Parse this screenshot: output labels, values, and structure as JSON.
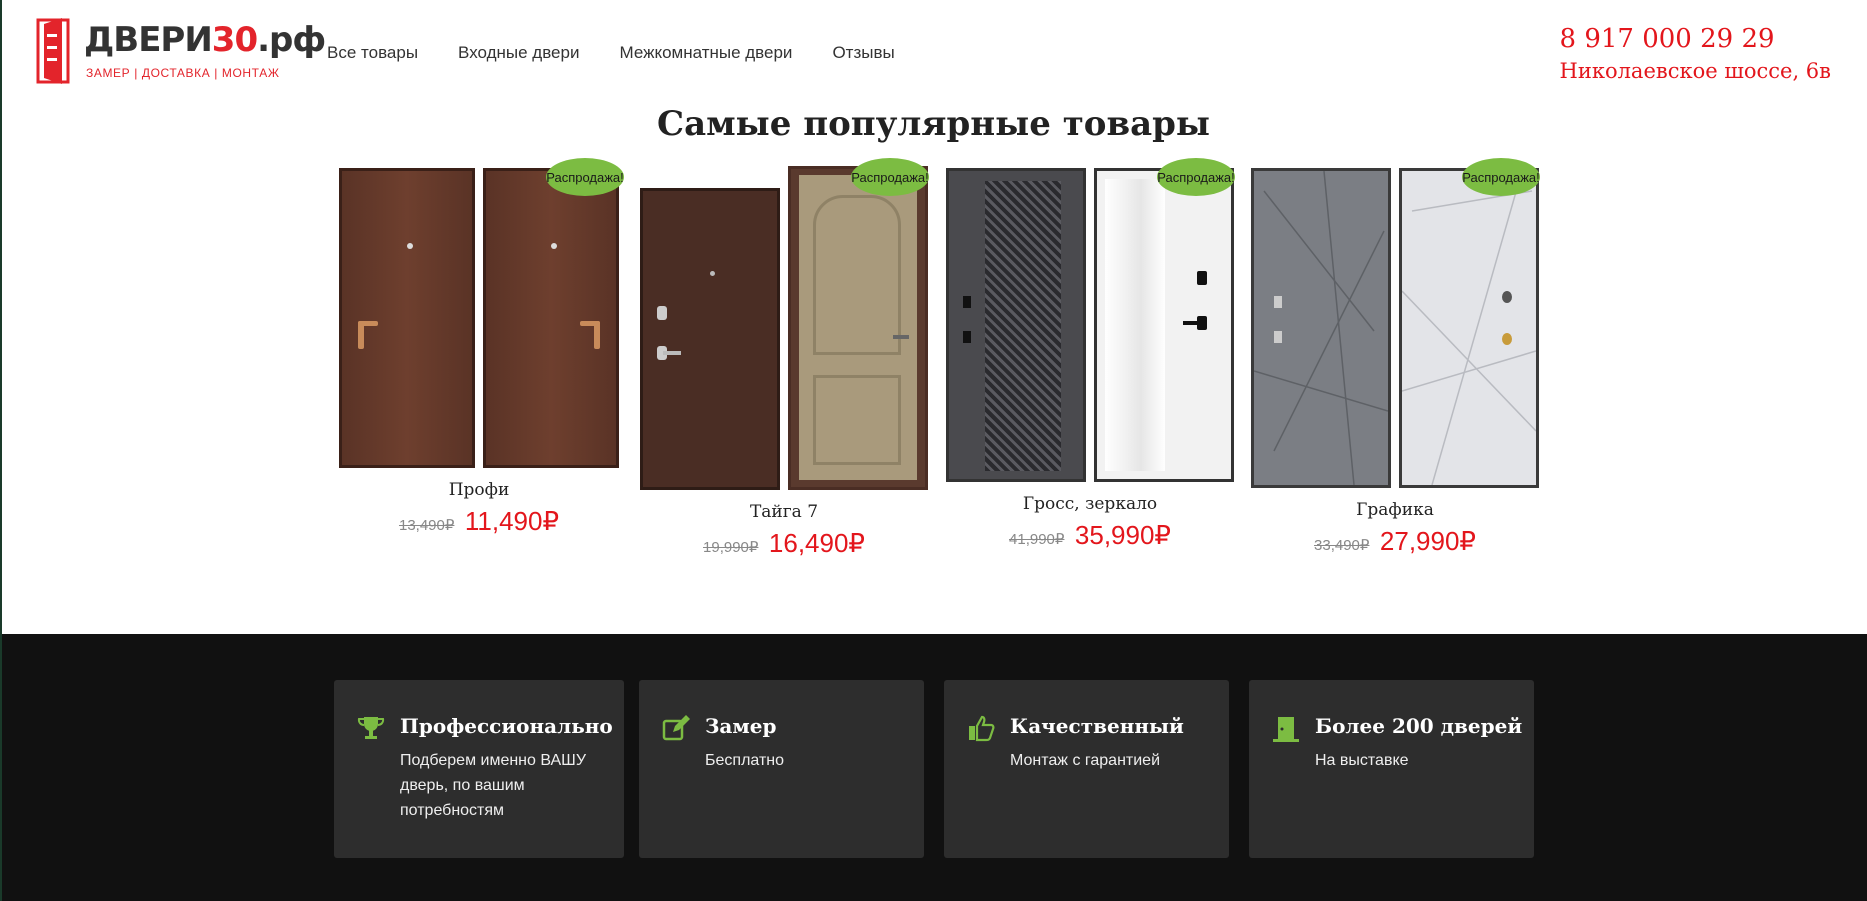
{
  "brand": {
    "name_main": "ДВЕРИ",
    "name_num": "30",
    "name_tld": ".рф",
    "tagline": "ЗАМЕР | ДОСТАВКА | МОНТАЖ",
    "color": "#e3242b"
  },
  "nav": {
    "items": [
      {
        "label": "Все товары"
      },
      {
        "label": "Входные двери"
      },
      {
        "label": "Межкомнатные двери"
      },
      {
        "label": "Отзывы"
      }
    ]
  },
  "contacts": {
    "phone": "8 917 000 29 29",
    "address": "Николаевское шоссе, 6в"
  },
  "popular": {
    "title": "Самые популярные товары",
    "sale_label": "Распродажа!",
    "products": [
      {
        "name": "Профи",
        "old_price": "13,490₽",
        "price": "11,490₽"
      },
      {
        "name": "Тайга 7",
        "old_price": "19,990₽",
        "price": "16,490₽"
      },
      {
        "name": "Гросс, зеркало",
        "old_price": "41,990₽",
        "price": "35,990₽"
      },
      {
        "name": "Графика",
        "old_price": "33,490₽",
        "price": "27,990₽"
      }
    ]
  },
  "features": [
    {
      "icon": "trophy-icon",
      "title": "Профессионально",
      "text": "Подберем именно ВАШУ дверь, по вашим потребностям"
    },
    {
      "icon": "edit-icon",
      "title": "Замер",
      "text": "Бесплатно"
    },
    {
      "icon": "thumbs-up-icon",
      "title": "Качественный",
      "text": "Монтаж с гарантией"
    },
    {
      "icon": "door-icon",
      "title": "Более 200 дверей",
      "text": "На выставке"
    }
  ],
  "colors": {
    "accent_red": "#e3161c",
    "sale_green": "#7cbc42",
    "band_bg": "#111111",
    "card_bg": "#2d2d2d",
    "icon_green": "#7cbc42"
  }
}
